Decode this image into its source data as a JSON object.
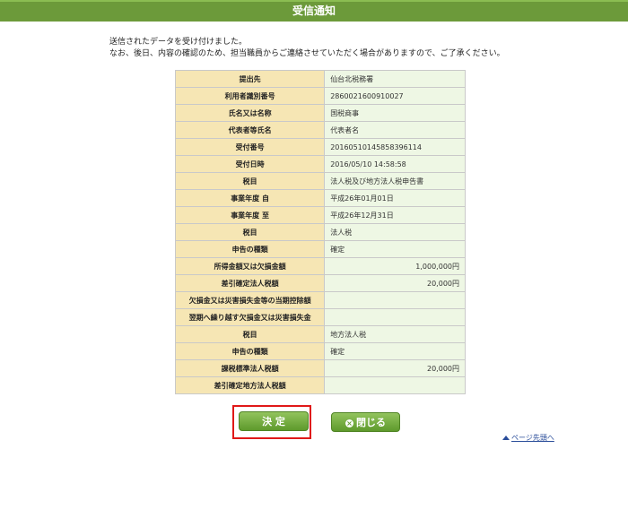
{
  "window": {
    "title": "受信通知"
  },
  "message": {
    "line1": "送信されたデータを受け付けました。",
    "line2": "なお、後日、内容の確認のため、担当職員からご連絡させていただく場合がありますので、ご了承ください。"
  },
  "table": {
    "rows": [
      {
        "label": "提出先",
        "value": "仙台北税務署"
      },
      {
        "label": "利用者識別番号",
        "value": "2860021600910027"
      },
      {
        "label": "氏名又は名称",
        "value": "国税商事"
      },
      {
        "label": "代表者等氏名",
        "value": "代表者名"
      },
      {
        "label": "受付番号",
        "value": "20160510145858396114"
      },
      {
        "label": "受付日時",
        "value": "2016/05/10 14:58:58"
      },
      {
        "label": "税目",
        "value": "法人税及び地方法人税申告書"
      },
      {
        "label": "事業年度 自",
        "value": "平成26年01月01日"
      },
      {
        "label": "事業年度 至",
        "value": "平成26年12月31日"
      },
      {
        "label": "税目",
        "value": "法人税"
      },
      {
        "label": "申告の種類",
        "value": "確定"
      },
      {
        "label": "所得金額又は欠損金額",
        "value": "1,000,000円"
      },
      {
        "label": "差引確定法人税額",
        "value": "20,000円"
      },
      {
        "label": "欠損金又は災害損失金等の当期控除額",
        "value": ""
      },
      {
        "label": "翌期へ繰り越す欠損金又は災害損失金",
        "value": ""
      },
      {
        "label": "税目",
        "value": "地方法人税"
      },
      {
        "label": "申告の種類",
        "value": "確定"
      },
      {
        "label": "課税標準法人税額",
        "value": "20,000円"
      },
      {
        "label": "差引確定地方法人税額",
        "value": ""
      }
    ]
  },
  "buttons": {
    "decide": "決 定",
    "close": "閉じる"
  },
  "links": {
    "page_top": "ページ先頭へ"
  },
  "colors": {
    "titlebar": "#6c9a3a",
    "label_bg": "#f6e6b4",
    "value_bg": "#eef7e4",
    "button": "#6aa336",
    "highlight": "#e01818"
  },
  "icons": {
    "close": "close-circle-icon",
    "page_top": "arrow-up-icon"
  }
}
